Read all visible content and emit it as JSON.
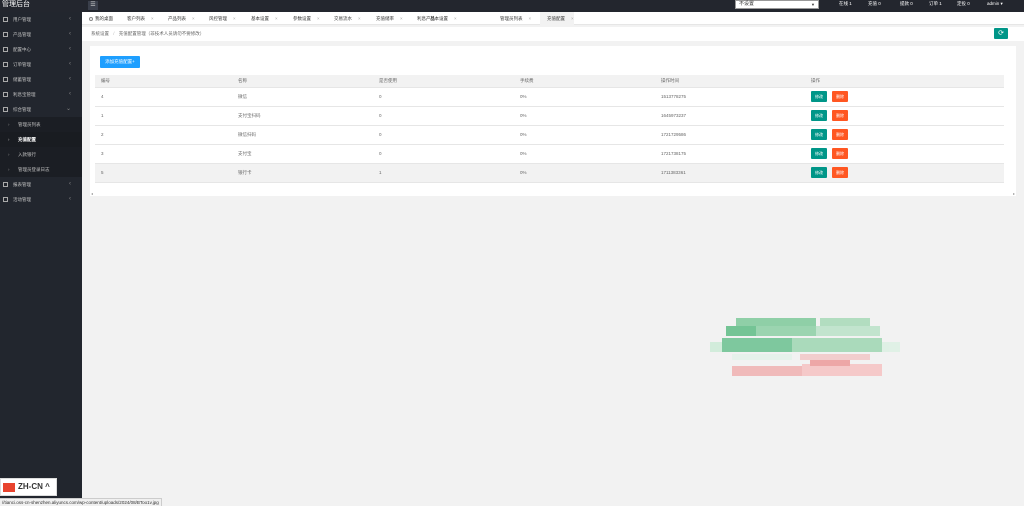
{
  "app": {
    "title": "管理后台"
  },
  "top": {
    "select_value": "不设置",
    "stats": [
      "在线 1",
      "充值 0",
      "提款 0",
      "订单 1",
      "定投 0"
    ],
    "user": "admin"
  },
  "sidebar": {
    "items": [
      {
        "label": "用户管理"
      },
      {
        "label": "产品管理"
      },
      {
        "label": "配置中心"
      },
      {
        "label": "订单管理"
      },
      {
        "label": "储蓄管理"
      },
      {
        "label": "利息宝管理"
      },
      {
        "label": "综合管理"
      }
    ],
    "sub": [
      {
        "label": "管理员列表"
      },
      {
        "label": "充值配置"
      },
      {
        "label": "入款银行"
      },
      {
        "label": "管理员登录日志"
      }
    ],
    "items2": [
      {
        "label": "报表管理"
      },
      {
        "label": "活动管理"
      }
    ]
  },
  "lang": {
    "label": "ZH-CN"
  },
  "tabs": [
    {
      "label": "我的桌面"
    },
    {
      "label": "客户列表"
    },
    {
      "label": "产品列表"
    },
    {
      "label": "风控管理"
    },
    {
      "label": "基本设置"
    },
    {
      "label": "参数设置"
    },
    {
      "label": "交易流水"
    },
    {
      "label": "充值储率"
    },
    {
      "label": "利息产品"
    },
    {
      "label": "基本设置"
    },
    {
      "label": "管理员列表"
    },
    {
      "label": "充值配置"
    }
  ],
  "breadcrumb": {
    "root": "系统设置",
    "sep": "/",
    "current": "充值配置管理（非技术人员请勿不要修改）"
  },
  "content": {
    "add_button": "添加充值配置+",
    "columns": [
      "编号",
      "名称",
      "是否使用",
      "手续费",
      "操作时间",
      "操作"
    ],
    "rows": [
      {
        "id": "4",
        "name": "微信",
        "used": "0",
        "fee": "0%",
        "time": "1513778275"
      },
      {
        "id": "1",
        "name": "支付宝扫码",
        "used": "0",
        "fee": "0%",
        "time": "1645973237"
      },
      {
        "id": "2",
        "name": "微信扫码",
        "used": "0",
        "fee": "0%",
        "time": "1721729586"
      },
      {
        "id": "3",
        "name": "支付宝",
        "used": "0",
        "fee": "0%",
        "time": "1721738175"
      },
      {
        "id": "5",
        "name": "银行卡",
        "used": "1",
        "fee": "0%",
        "time": "1711383361"
      }
    ],
    "edit_label": "修改",
    "delete_label": "删除"
  },
  "status_url": "//tianci.oss-cn-shenzhen.aliyuncs.com/wp-content/uploads/2024/08/BToo1v.jpg",
  "colors": {
    "accent": "#009688",
    "danger": "#ff5722",
    "primary": "#1e9fff",
    "sidebar": "#22262e"
  }
}
